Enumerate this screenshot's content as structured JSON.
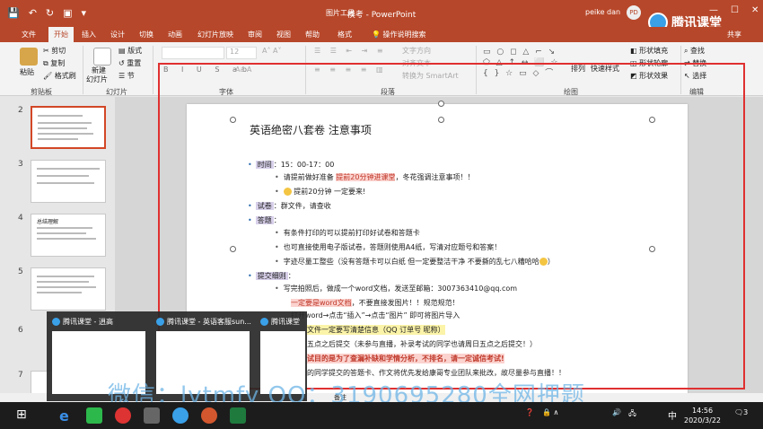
{
  "titlebar": {
    "doc_title": "模考  -  PowerPoint",
    "context_tools": "图片工具",
    "user_name": "peike dan",
    "user_initials": "PD",
    "brand": "腾讯课堂",
    "share": "共享"
  },
  "tabs": [
    "文件",
    "开始",
    "插入",
    "设计",
    "切换",
    "动画",
    "幻灯片放映",
    "审阅",
    "视图",
    "帮助",
    "格式",
    "操作说明搜索"
  ],
  "ribbon": {
    "clipboard": {
      "paste": "粘贴",
      "cut": "剪切",
      "copy": "复制",
      "format_painter": "格式刷",
      "group": "剪贴板"
    },
    "slides": {
      "new_slide": "新建",
      "new_slide2": "幻灯片",
      "layout": "版式",
      "reset": "重置",
      "section": "节",
      "group": "幻灯片"
    },
    "font": {
      "size": "12",
      "group": "字体"
    },
    "paragraph": {
      "text_dir": "文字方向",
      "align": "对齐文本",
      "smartart": "转换为 SmartArt",
      "group": "段落"
    },
    "drawing": {
      "arrange": "排列",
      "quick_styles": "快速样式",
      "fill": "形状填充",
      "outline": "形状轮廓",
      "effects": "形状效果",
      "group": "绘图"
    },
    "editing": {
      "find": "查找",
      "replace": "替换",
      "select": "选择",
      "group": "编辑"
    }
  },
  "thumbs": [
    {
      "num": "2"
    },
    {
      "num": "3"
    },
    {
      "num": "4",
      "title": "总结理解"
    },
    {
      "num": "5"
    },
    {
      "num": "6"
    },
    {
      "num": "7"
    }
  ],
  "slide": {
    "title": "英语绝密八套卷 注意事项",
    "time_label": "时间",
    "time_value": "15：00-17：00",
    "line1a": "请提前做好准备",
    "line1b": "提前20分钟进课堂",
    "line1c": "，冬花强调注意事项！！",
    "line2": "提前20分钟 一定要来!",
    "paper_label": "试卷",
    "paper_value": "群文件，请查收",
    "answer_label": "答题",
    "ans1": "有条件打印的可以提前打印好试卷和答题卡",
    "ans2": "也可直接使用电子版试卷，答题则使用A4纸，写清对应题号和答案！",
    "ans3": "字迹尽量工整些（没有答题卡可以白纸 但一定要整洁干净 不要撕的乱七八糟哈哈",
    "submit_label": "提交细则",
    "sub1": "写完拍照后，做成一个word文档，发送至邮箱：3007363410@qq.com",
    "sub2a": "一定要是word文档",
    "sub2b": "，不要直接发图片！！规范规范！",
    "sub3": "打开word→点击“插入”→点击“图片” 即可将图片导入",
    "sub4": "文件一定要写清楚信息（QQ 订单号 昵称）",
    "sub5": "五点之后提交（未参与直播，补录考试的同学也请周日五点之后提交！）",
    "sub6": "试目的是为了查漏补缺和学情分析，不排名，请一定诚信考试!",
    "sub7": "的同学提交的答题卡、作文将优先发给康哥专业团队来批改，故尽量参与直播！！"
  },
  "previews": [
    {
      "title": "腾讯课堂 - 逍高"
    },
    {
      "title": "腾讯课堂 - 英语客服sun..."
    },
    {
      "title": "腾讯课堂"
    }
  ],
  "status_text": "备注",
  "watermark": "微信：lvtmfy  QQ：3190695280全网押题",
  "taskbar": {
    "time": "14:56",
    "date": "2020/3/22",
    "lang": "中",
    "notif": "3"
  }
}
